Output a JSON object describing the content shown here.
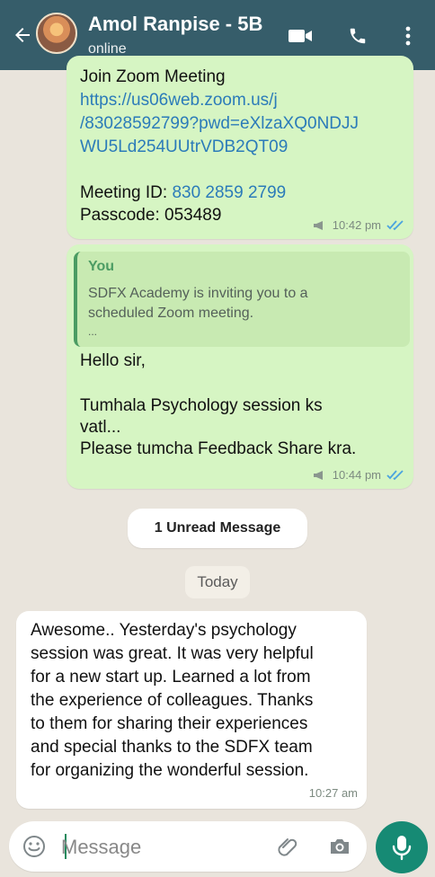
{
  "header": {
    "title": "Amol Ranpise - 5B",
    "status": "online",
    "icons": [
      "back-arrow-icon",
      "video-call-icon",
      "phone-icon",
      "more-icon"
    ]
  },
  "messages": [
    {
      "sender": "You",
      "lines": [
        "Join Zoom Meeting",
        "https://us06web.zoom.us/j",
        "/83028592799?pwd=eXlzaXQ0NDJJ",
        "WU5Ld254UUtrVDB2QT09",
        "Meeting ID: ",
        "830 2859 2799",
        "Passcode: 053489"
      ],
      "time": "10:42 pm",
      "status": "read"
    },
    {
      "sender": "You",
      "quote": {
        "name": "You",
        "lines": [
          "SDFX Academy is inviting you to a",
          "scheduled Zoom meeting.",
          "..."
        ]
      },
      "lines": [
        "Hello sir,",
        "Tumhala Psychology session ks",
        "vatl...",
        "Please tumcha Feedback Share kra."
      ],
      "time": "10:44 pm",
      "status": "read"
    },
    {
      "sender": "Amol Ranpise - 5B",
      "lines": [
        "Awesome.. Yesterday's psychology",
        "session was great. It was very helpful",
        "for a new start up. Learned a lot from",
        "the experience of colleagues. Thanks",
        "to them for sharing their experiences",
        "and special thanks to the SDFX team",
        "for organizing the wonderful session."
      ],
      "time": "10:27 am"
    }
  ],
  "unread": {
    "label": "1 Unread Message"
  },
  "date": {
    "label": "Today"
  },
  "composer": {
    "placeholder": "Message"
  }
}
